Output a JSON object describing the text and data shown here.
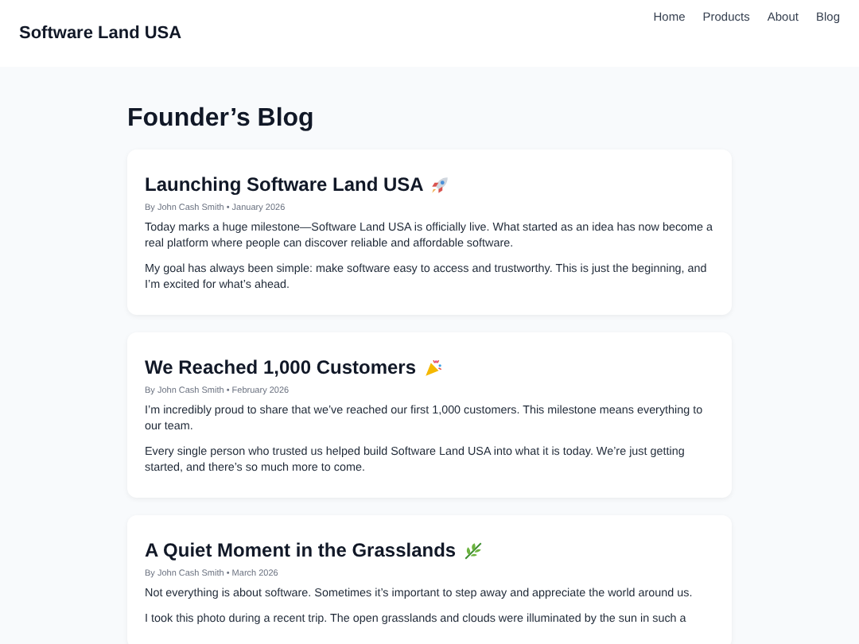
{
  "header": {
    "brand": "Software Land USA",
    "nav": [
      {
        "label": "Home"
      },
      {
        "label": "Products"
      },
      {
        "label": "About"
      },
      {
        "label": "Blog"
      }
    ]
  },
  "page_title": "Founder’s Blog",
  "posts": [
    {
      "title": "Launching Software Land USA",
      "kind": "rocket",
      "meta": "By John Cash Smith • January 2026",
      "paragraphs": [
        "Today marks a huge milestone—Software Land USA is officially live. What started as an idea has now become a real platform where people can discover reliable and affordable software.",
        "My goal has always been simple: make software easy to access and trustworthy. This is just the beginning, and I’m excited for what’s ahead."
      ]
    },
    {
      "title": "We Reached 1,000 Customers",
      "kind": "party",
      "meta": "By John Cash Smith • February 2026",
      "paragraphs": [
        "I’m incredibly proud to share that we’ve reached our first 1,000 customers. This milestone means everything to our team.",
        "Every single person who trusted us helped build Software Land USA into what it is today. We’re just getting started, and there’s so much more to come."
      ]
    },
    {
      "title": "A Quiet Moment in the Grasslands",
      "kind": "leaf",
      "meta": "By John Cash Smith • March 2026",
      "paragraphs": [
        "Not everything is about software. Sometimes it’s important to step away and appreciate the world around us.",
        "I took this photo during a recent trip. The open grasslands and clouds were illuminated by the sun in such a"
      ]
    }
  ]
}
